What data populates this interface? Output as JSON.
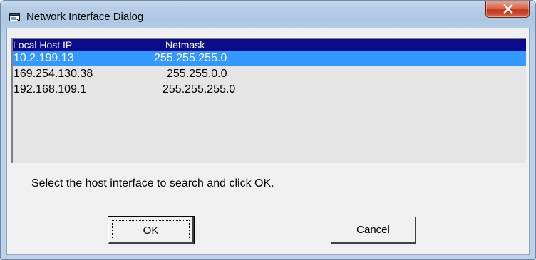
{
  "window": {
    "title": "Network Interface Dialog",
    "icon": "app-window-icon",
    "close_icon": "close-icon"
  },
  "list": {
    "columns": {
      "ip": "Local  Host IP",
      "netmask": "Netmask"
    },
    "rows": [
      {
        "ip": "10.2.199.13",
        "netmask": "255.255.255.0",
        "selected": true
      },
      {
        "ip": "169.254.130.38",
        "netmask": "255.255.0.0",
        "selected": false
      },
      {
        "ip": "192.168.109.1",
        "netmask": "255.255.255.0",
        "selected": false
      }
    ]
  },
  "instruction": "Select the host interface to search and click OK.",
  "buttons": {
    "ok": "OK",
    "cancel": "Cancel"
  },
  "colors": {
    "header_bg": "#0a0a8a",
    "selection_bg": "#3399ff",
    "close_button": "#c94a2f"
  }
}
